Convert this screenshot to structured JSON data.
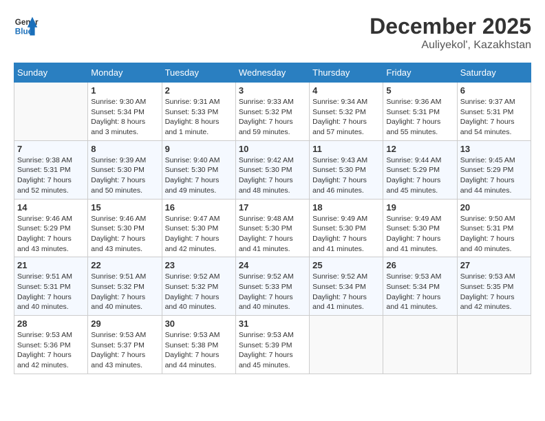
{
  "header": {
    "logo_line1": "General",
    "logo_line2": "Blue",
    "month": "December 2025",
    "location": "Auliyekol', Kazakhstan"
  },
  "weekdays": [
    "Sunday",
    "Monday",
    "Tuesday",
    "Wednesday",
    "Thursday",
    "Friday",
    "Saturday"
  ],
  "weeks": [
    [
      {
        "empty": true
      },
      {
        "day": 1,
        "sunrise": "9:30 AM",
        "sunset": "5:34 PM",
        "daylight": "8 hours and 3 minutes."
      },
      {
        "day": 2,
        "sunrise": "9:31 AM",
        "sunset": "5:33 PM",
        "daylight": "8 hours and 1 minute."
      },
      {
        "day": 3,
        "sunrise": "9:33 AM",
        "sunset": "5:32 PM",
        "daylight": "7 hours and 59 minutes."
      },
      {
        "day": 4,
        "sunrise": "9:34 AM",
        "sunset": "5:32 PM",
        "daylight": "7 hours and 57 minutes."
      },
      {
        "day": 5,
        "sunrise": "9:36 AM",
        "sunset": "5:31 PM",
        "daylight": "7 hours and 55 minutes."
      },
      {
        "day": 6,
        "sunrise": "9:37 AM",
        "sunset": "5:31 PM",
        "daylight": "7 hours and 54 minutes."
      }
    ],
    [
      {
        "day": 7,
        "sunrise": "9:38 AM",
        "sunset": "5:31 PM",
        "daylight": "7 hours and 52 minutes."
      },
      {
        "day": 8,
        "sunrise": "9:39 AM",
        "sunset": "5:30 PM",
        "daylight": "7 hours and 50 minutes."
      },
      {
        "day": 9,
        "sunrise": "9:40 AM",
        "sunset": "5:30 PM",
        "daylight": "7 hours and 49 minutes."
      },
      {
        "day": 10,
        "sunrise": "9:42 AM",
        "sunset": "5:30 PM",
        "daylight": "7 hours and 48 minutes."
      },
      {
        "day": 11,
        "sunrise": "9:43 AM",
        "sunset": "5:30 PM",
        "daylight": "7 hours and 46 minutes."
      },
      {
        "day": 12,
        "sunrise": "9:44 AM",
        "sunset": "5:29 PM",
        "daylight": "7 hours and 45 minutes."
      },
      {
        "day": 13,
        "sunrise": "9:45 AM",
        "sunset": "5:29 PM",
        "daylight": "7 hours and 44 minutes."
      }
    ],
    [
      {
        "day": 14,
        "sunrise": "9:46 AM",
        "sunset": "5:29 PM",
        "daylight": "7 hours and 43 minutes."
      },
      {
        "day": 15,
        "sunrise": "9:46 AM",
        "sunset": "5:30 PM",
        "daylight": "7 hours and 43 minutes."
      },
      {
        "day": 16,
        "sunrise": "9:47 AM",
        "sunset": "5:30 PM",
        "daylight": "7 hours and 42 minutes."
      },
      {
        "day": 17,
        "sunrise": "9:48 AM",
        "sunset": "5:30 PM",
        "daylight": "7 hours and 41 minutes."
      },
      {
        "day": 18,
        "sunrise": "9:49 AM",
        "sunset": "5:30 PM",
        "daylight": "7 hours and 41 minutes."
      },
      {
        "day": 19,
        "sunrise": "9:49 AM",
        "sunset": "5:30 PM",
        "daylight": "7 hours and 41 minutes."
      },
      {
        "day": 20,
        "sunrise": "9:50 AM",
        "sunset": "5:31 PM",
        "daylight": "7 hours and 40 minutes."
      }
    ],
    [
      {
        "day": 21,
        "sunrise": "9:51 AM",
        "sunset": "5:31 PM",
        "daylight": "7 hours and 40 minutes."
      },
      {
        "day": 22,
        "sunrise": "9:51 AM",
        "sunset": "5:32 PM",
        "daylight": "7 hours and 40 minutes."
      },
      {
        "day": 23,
        "sunrise": "9:52 AM",
        "sunset": "5:32 PM",
        "daylight": "7 hours and 40 minutes."
      },
      {
        "day": 24,
        "sunrise": "9:52 AM",
        "sunset": "5:33 PM",
        "daylight": "7 hours and 40 minutes."
      },
      {
        "day": 25,
        "sunrise": "9:52 AM",
        "sunset": "5:34 PM",
        "daylight": "7 hours and 41 minutes."
      },
      {
        "day": 26,
        "sunrise": "9:53 AM",
        "sunset": "5:34 PM",
        "daylight": "7 hours and 41 minutes."
      },
      {
        "day": 27,
        "sunrise": "9:53 AM",
        "sunset": "5:35 PM",
        "daylight": "7 hours and 42 minutes."
      }
    ],
    [
      {
        "day": 28,
        "sunrise": "9:53 AM",
        "sunset": "5:36 PM",
        "daylight": "7 hours and 42 minutes."
      },
      {
        "day": 29,
        "sunrise": "9:53 AM",
        "sunset": "5:37 PM",
        "daylight": "7 hours and 43 minutes."
      },
      {
        "day": 30,
        "sunrise": "9:53 AM",
        "sunset": "5:38 PM",
        "daylight": "7 hours and 44 minutes."
      },
      {
        "day": 31,
        "sunrise": "9:53 AM",
        "sunset": "5:39 PM",
        "daylight": "7 hours and 45 minutes."
      },
      {
        "empty": true
      },
      {
        "empty": true
      },
      {
        "empty": true
      }
    ]
  ]
}
